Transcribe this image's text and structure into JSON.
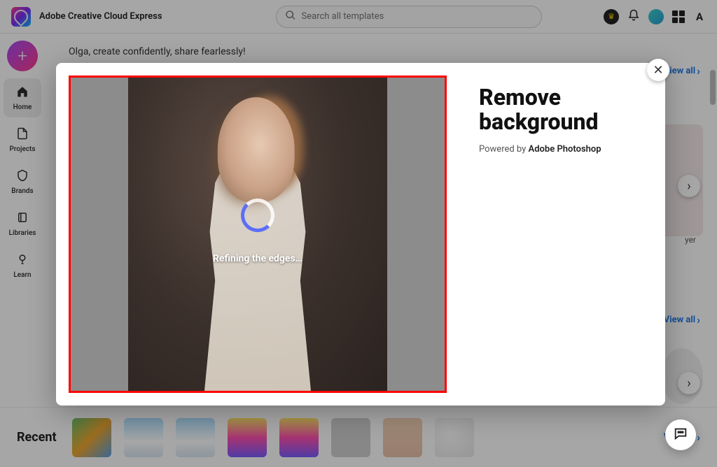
{
  "app_name": "Adobe Creative Cloud Express",
  "search": {
    "placeholder": "Search all templates"
  },
  "sidebar": {
    "items": [
      {
        "label": "Home"
      },
      {
        "label": "Projects"
      },
      {
        "label": "Brands"
      },
      {
        "label": "Libraries"
      },
      {
        "label": "Learn"
      }
    ]
  },
  "greeting": "Olga, create confidently, share fearlessly!",
  "sections": {
    "s1_viewall": "View all",
    "s2_viewall": "View all",
    "peek_caption": "yer"
  },
  "recent": {
    "title": "Recent",
    "viewall": "View all"
  },
  "modal": {
    "title": "Remove background",
    "subtitle_prefix": "Powered by ",
    "subtitle_brand": "Adobe Photoshop",
    "spinner_label": "Refining the edges…"
  }
}
